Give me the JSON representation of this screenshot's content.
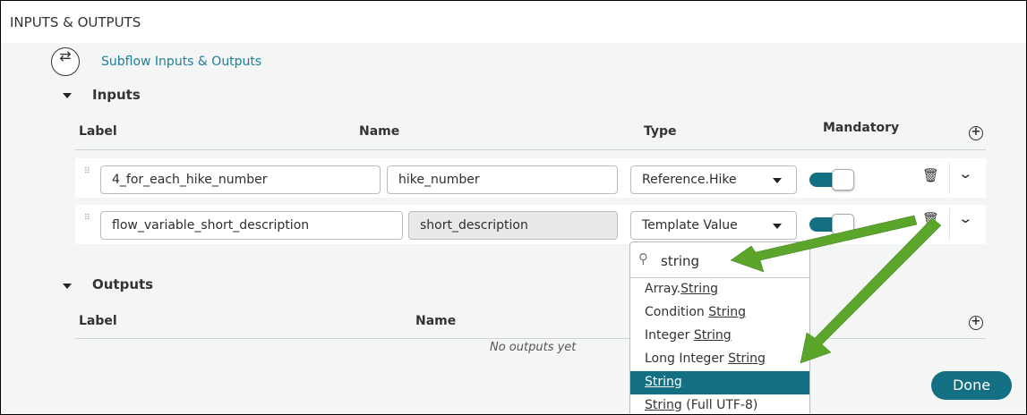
{
  "header": {
    "title": "INPUTS & OUTPUTS"
  },
  "subflow_link": "Subflow Inputs & Outputs",
  "inputs": {
    "title": "Inputs",
    "columns": {
      "label": "Label",
      "name": "Name",
      "type": "Type",
      "mandatory": "Mandatory"
    },
    "rows": [
      {
        "label": "4_for_each_hike_number",
        "name": "hike_number",
        "type": "Reference.Hike",
        "mandatory": true
      },
      {
        "label": "flow_variable_short_description",
        "name": "short_description",
        "type": "Template Value",
        "mandatory": true
      }
    ]
  },
  "outputs": {
    "title": "Outputs",
    "columns": {
      "label": "Label",
      "name": "Name"
    },
    "empty": "No outputs yet"
  },
  "dropdown": {
    "search_value": "string",
    "options": [
      {
        "pre": "Array.",
        "match": "String",
        "post": ""
      },
      {
        "pre": "Condition ",
        "match": "String",
        "post": ""
      },
      {
        "pre": "Integer ",
        "match": "String",
        "post": ""
      },
      {
        "pre": "Long Integer ",
        "match": "String",
        "post": ""
      },
      {
        "pre": "",
        "match": "String",
        "post": "",
        "selected": true
      },
      {
        "pre": "",
        "match": "String",
        "post": " (Full UTF-8)"
      }
    ]
  },
  "done_label": "Done",
  "colors": {
    "accent": "#137083",
    "arrow": "#5aa52a"
  }
}
